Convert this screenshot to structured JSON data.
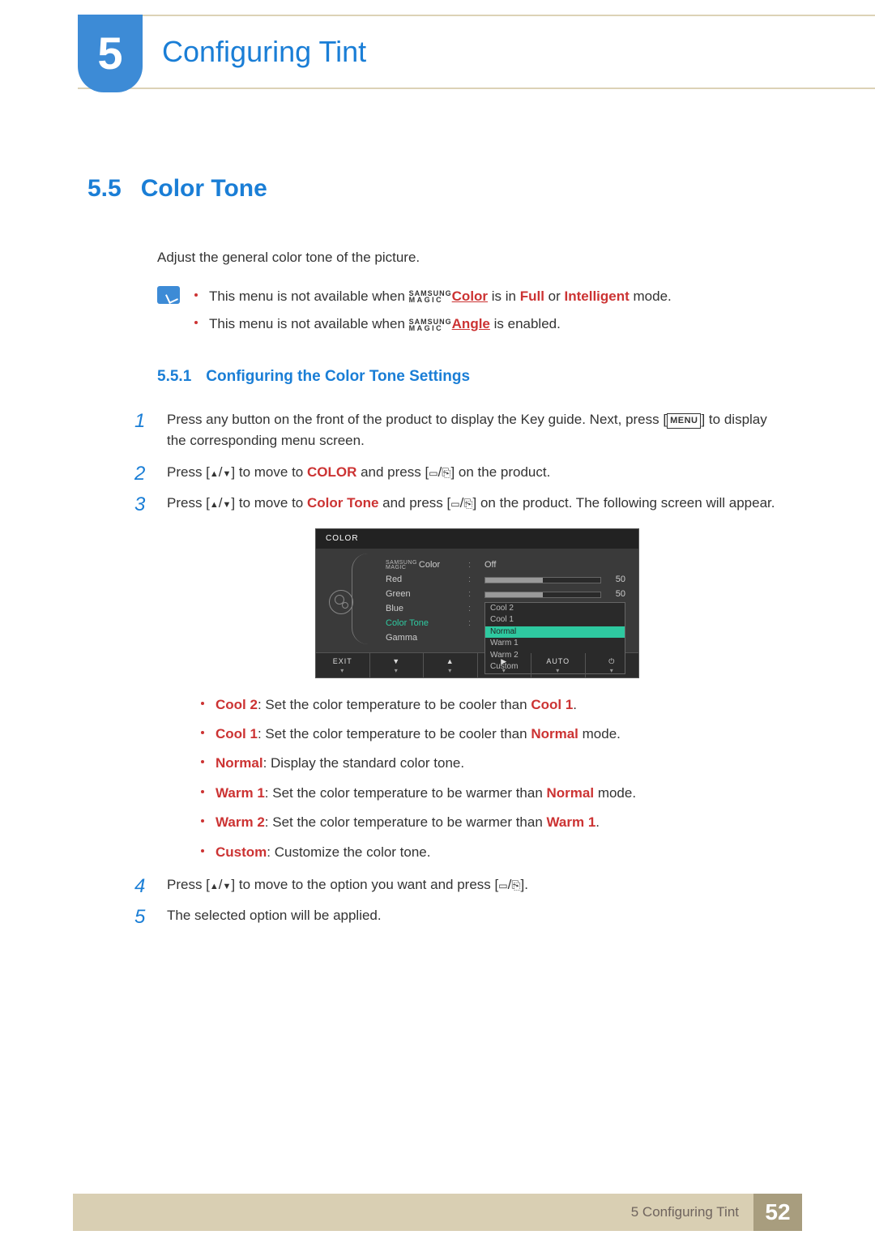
{
  "header": {
    "chapter_number": "5",
    "chapter_title": "Configuring Tint"
  },
  "section": {
    "number": "5.5",
    "title": "Color Tone",
    "lead": "Adjust the general color tone of the picture."
  },
  "magic_brand": {
    "top": "SAMSUNG",
    "bottom": "MAGIC"
  },
  "notes": {
    "item1": {
      "prefix": "This menu is not available when ",
      "magic_word": "Color",
      "mid": " is in ",
      "kw1": "Full",
      "or": " or ",
      "kw2": "Intelligent",
      "suffix": " mode."
    },
    "item2": {
      "prefix": "This menu is not available when ",
      "magic_word": "Angle",
      "suffix": " is enabled."
    }
  },
  "subsection": {
    "number": "5.5.1",
    "title": "Configuring the Color Tone Settings"
  },
  "steps": {
    "s1": {
      "num": "1",
      "a": "Press any button on the front of the product to display the Key guide. Next, press [",
      "menu": "MENU",
      "b": "] to display the corresponding menu screen."
    },
    "s2": {
      "num": "2",
      "a": "Press [",
      "b": "] to move to ",
      "kw": "COLOR",
      "c": " and press [",
      "d": "] on the product."
    },
    "s3": {
      "num": "3",
      "a": "Press [",
      "b": "] to move to ",
      "kw": "Color Tone",
      "c": " and press [",
      "d": "] on the product. The following screen will appear."
    },
    "s4": {
      "num": "4",
      "a": "Press [",
      "b": "] to move to the option you want and press [",
      "c": "]."
    },
    "s5": {
      "num": "5",
      "text": "The selected option will be applied."
    }
  },
  "osd": {
    "title": "COLOR",
    "rows": {
      "magic_color": {
        "label": "Color",
        "value": "Off"
      },
      "red": {
        "label": "Red",
        "value": 50
      },
      "green": {
        "label": "Green",
        "value": 50
      },
      "blue": {
        "label": "Blue"
      },
      "color_tone": {
        "label": "Color Tone"
      },
      "gamma": {
        "label": "Gamma"
      }
    },
    "dropdown": [
      "Cool 2",
      "Cool 1",
      "Normal",
      "Warm 1",
      "Warm 2",
      "Custom"
    ],
    "dropdown_selected": "Normal",
    "footer": {
      "exit": "EXIT",
      "down": "▼",
      "up": "▲",
      "right": "▶",
      "auto": "AUTO",
      "power": "⏻",
      "sub": "▾"
    }
  },
  "options": {
    "cool2": {
      "kw": "Cool 2",
      "a": ": Set the color temperature to be cooler than ",
      "kw2": "Cool 1",
      "b": "."
    },
    "cool1": {
      "kw": "Cool 1",
      "a": ": Set the color temperature to be cooler than ",
      "kw2": "Normal",
      "b": " mode."
    },
    "normal": {
      "kw": "Normal",
      "a": ": Display the standard color tone."
    },
    "warm1": {
      "kw": "Warm 1",
      "a": ": Set the color temperature to be warmer than ",
      "kw2": "Normal",
      "b": " mode."
    },
    "warm2": {
      "kw": "Warm 2",
      "a": ": Set the color temperature to be warmer than ",
      "kw2": "Warm 1",
      "b": "."
    },
    "custom": {
      "kw": "Custom",
      "a": ": Customize the color tone."
    }
  },
  "footer": {
    "text": "5 Configuring Tint",
    "page": "52"
  }
}
